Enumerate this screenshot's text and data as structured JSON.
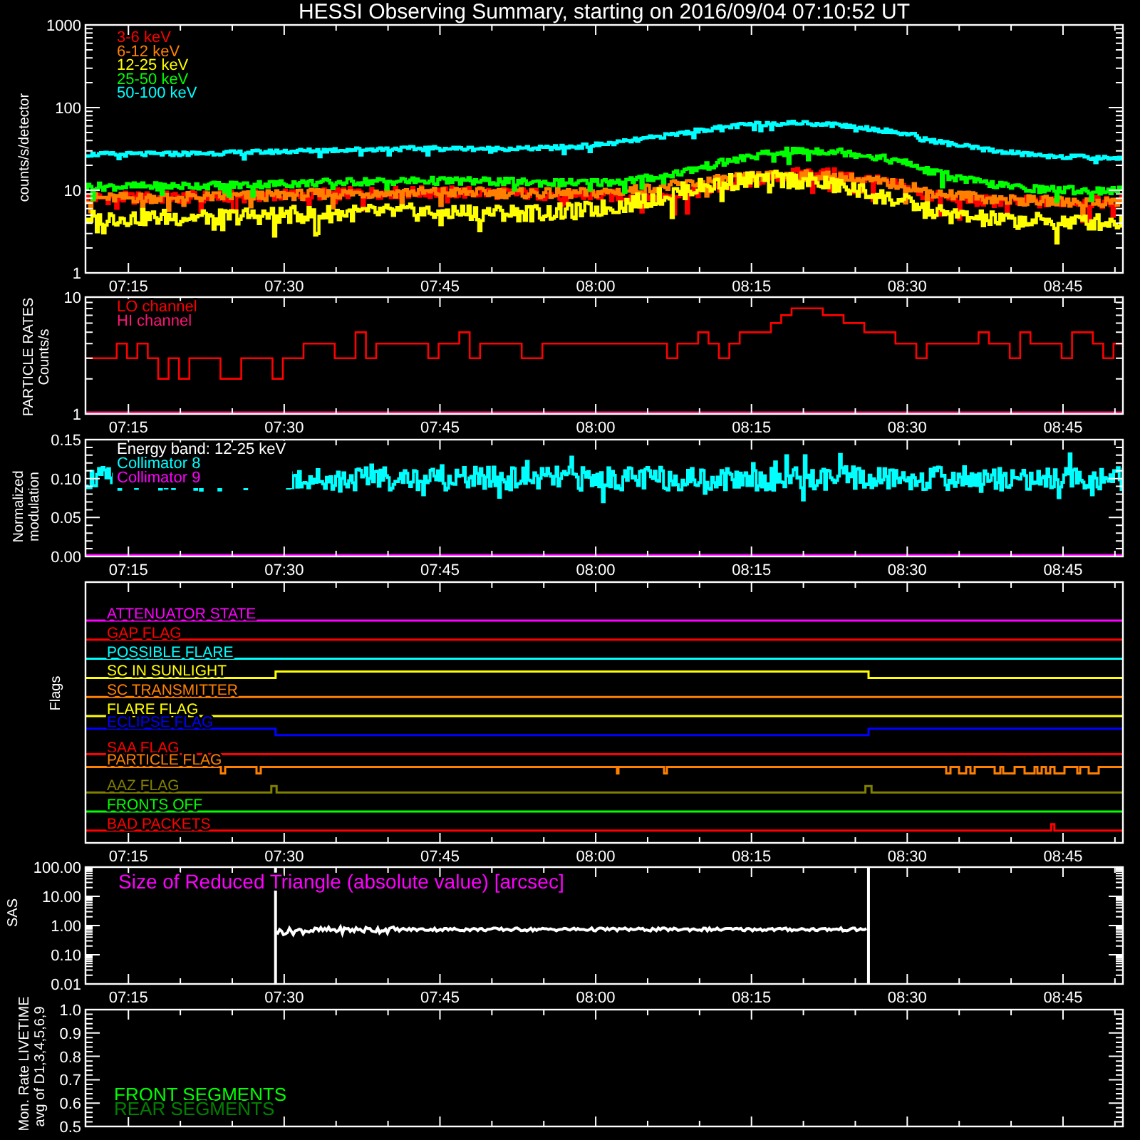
{
  "title": "HESSI Observing Summary, starting on 2016/09/04 07:10:52 UT",
  "panels": [
    {
      "kind": "counts",
      "ylabel": [
        "counts/s/detector"
      ],
      "yticks": [
        "1000",
        "100",
        "10",
        "1"
      ],
      "xticks": [
        "07:15",
        "07:30",
        "07:45",
        "08:00",
        "08:15",
        "08:30",
        "08:45"
      ],
      "legend": [
        {
          "label": "3-6 keV",
          "color": "#ff0000"
        },
        {
          "label": "6-12 keV",
          "color": "#ff8000"
        },
        {
          "label": "12-25 keV",
          "color": "#ffff00"
        },
        {
          "label": "25-50 keV",
          "color": "#00ff00"
        },
        {
          "label": "50-100 keV",
          "color": "#00ffff"
        }
      ]
    },
    {
      "kind": "particle",
      "ylabel": [
        "PARTICLE RATES",
        "Counts/s"
      ],
      "yticks": [
        "10",
        "1"
      ],
      "xticks": [
        "07:15",
        "07:30",
        "07:45",
        "08:00",
        "08:15",
        "08:30",
        "08:45"
      ],
      "legend": [
        {
          "label": "LO channel",
          "color": "#ff0000"
        },
        {
          "label": "HI channel",
          "color": "#ff1478"
        }
      ]
    },
    {
      "kind": "modulation",
      "ylabel": [
        "Normalized",
        "modulation"
      ],
      "yticks": [
        "0.15",
        "0.10",
        "0.05",
        "0.00"
      ],
      "xticks": [
        "07:15",
        "07:30",
        "07:45",
        "08:00",
        "08:15",
        "08:30",
        "08:45"
      ],
      "legend": [
        {
          "label": "Energy band: 12-25 keV",
          "color": "#ffffff"
        },
        {
          "label": "Collimator 8",
          "color": "#00ffff"
        },
        {
          "label": "Collimator 9",
          "color": "#ff00ff"
        }
      ]
    },
    {
      "kind": "flags",
      "ylabel": [
        "Flags"
      ],
      "xticks": [
        "07:15",
        "07:30",
        "07:45",
        "08:00",
        "08:15",
        "08:30",
        "08:45"
      ],
      "flags": [
        {
          "label": "ATTENUATOR STATE",
          "color": "#ff00ff"
        },
        {
          "label": "GAP FLAG",
          "color": "#ff0000"
        },
        {
          "label": "POSSIBLE FLARE",
          "color": "#00ffff"
        },
        {
          "label": "SC IN SUNLIGHT",
          "color": "#ffff00"
        },
        {
          "label": "SC TRANSMITTER",
          "color": "#ff8000"
        },
        {
          "label": "FLARE FLAG",
          "color": "#ffff00"
        },
        {
          "label": "ECLIPSE FLAG",
          "color": "#0000ff"
        },
        {
          "label": "SAA FLAG",
          "color": "#ff0000"
        },
        {
          "label": "PARTICLE FLAG",
          "color": "#ff8000"
        },
        {
          "label": "AAZ FLAG",
          "color": "#808000"
        },
        {
          "label": "FRONTS OFF",
          "color": "#00ff00"
        },
        {
          "label": "BAD PACKETS",
          "color": "#ff0000"
        }
      ]
    },
    {
      "kind": "sas",
      "ylabel": [
        "SAS"
      ],
      "yticks": [
        "100.00",
        "10.00",
        "1.00",
        "0.10",
        "0.01"
      ],
      "xticks": [
        "07:15",
        "07:30",
        "07:45",
        "08:00",
        "08:15",
        "08:30",
        "08:45"
      ],
      "caption": "Size of Reduced Triangle (absolute value) [arcsec]"
    },
    {
      "kind": "livetime",
      "ylabel": [
        "Mon. Rate LIVETIME",
        "avg of D1,3,4,5,6,9"
      ],
      "yticks": [
        "1.0",
        "0.9",
        "0.8",
        "0.7",
        "0.6",
        "0.5"
      ],
      "legend": [
        {
          "label": "FRONT SEGMENTS",
          "color": "#00ff00"
        },
        {
          "label": "REAR SEGMENTS",
          "color": "#008000"
        }
      ]
    }
  ]
}
